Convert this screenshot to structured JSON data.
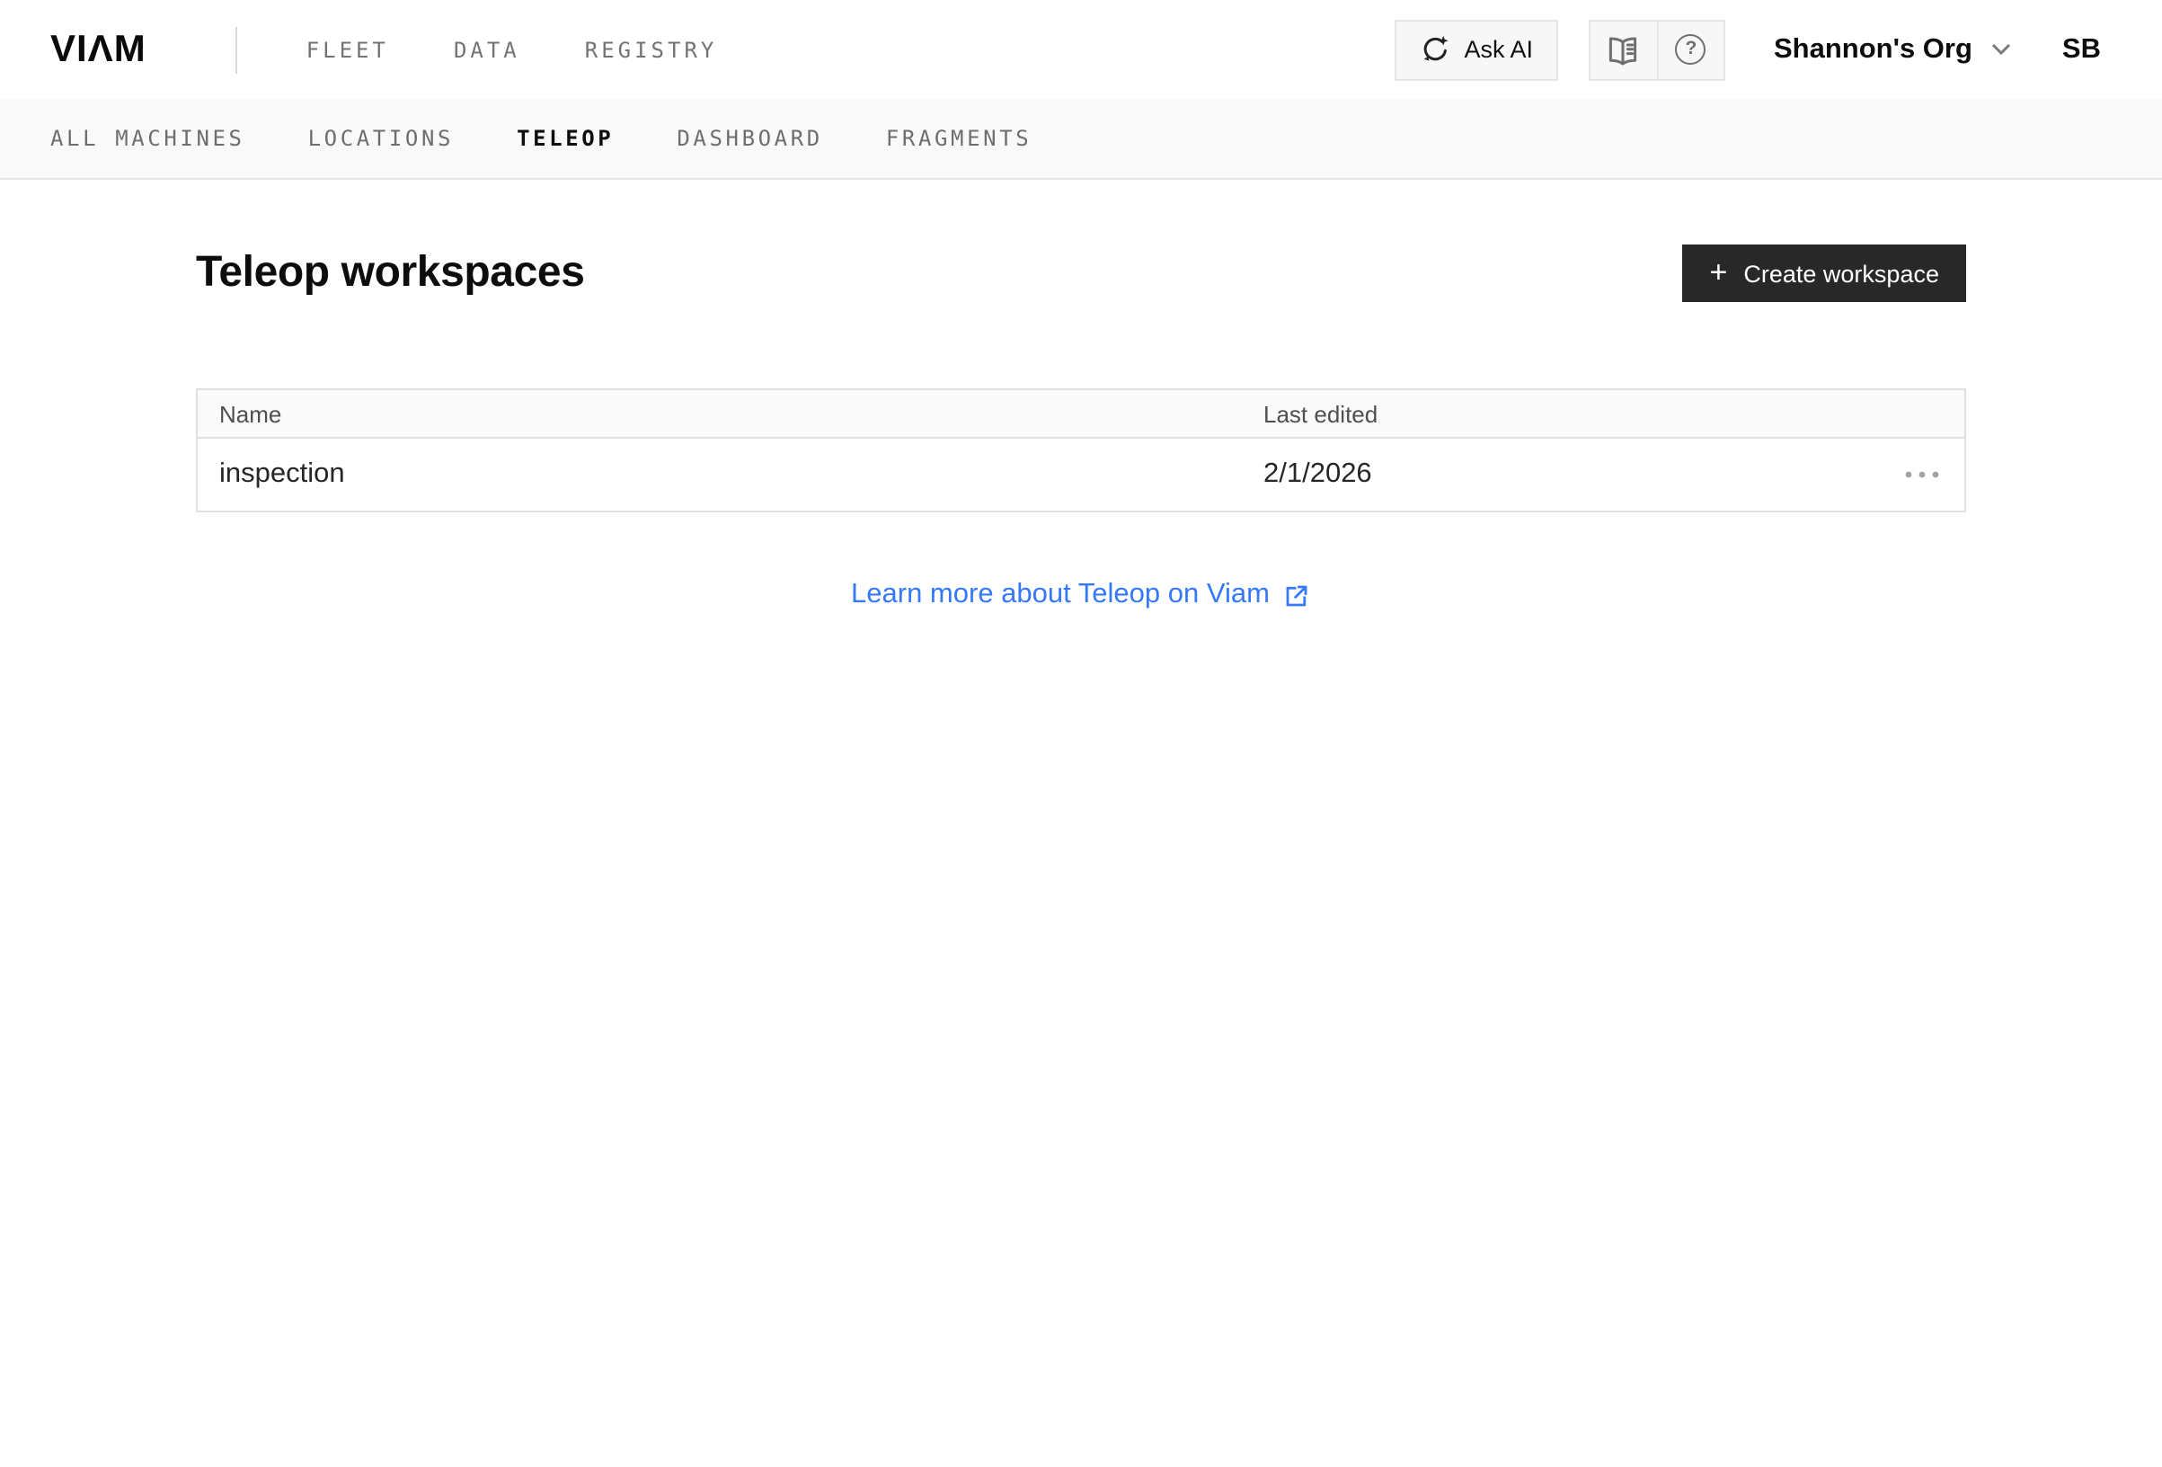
{
  "brand": {
    "logo_text": "VIΛM"
  },
  "header": {
    "nav_items": [
      {
        "label": "FLEET"
      },
      {
        "label": "DATA"
      },
      {
        "label": "REGISTRY"
      }
    ],
    "ask_ai_label": "Ask AI",
    "org_name": "Shannon's Org",
    "avatar_initials": "SB"
  },
  "subnav": {
    "items": [
      {
        "label": "ALL MACHINES",
        "active": false
      },
      {
        "label": "LOCATIONS",
        "active": false
      },
      {
        "label": "TELEOP",
        "active": true
      },
      {
        "label": "DASHBOARD",
        "active": false
      },
      {
        "label": "FRAGMENTS",
        "active": false
      }
    ]
  },
  "main": {
    "title": "Teleop workspaces",
    "create_button_label": "Create workspace",
    "table": {
      "columns": {
        "name": "Name",
        "last_edited": "Last edited"
      },
      "rows": [
        {
          "name": "inspection",
          "last_edited": "2/1/2026"
        }
      ]
    },
    "learn_more_label": "Learn more about Teleop on Viam"
  },
  "icons": {
    "ask_ai": "sparkle-sync-icon",
    "docs": "open-book-icon",
    "help": "question-circle-icon",
    "help_glyph": "?",
    "org_chevron": "chevron-down-icon",
    "plus_glyph": "+",
    "row_menu": "ellipsis-icon",
    "external_link": "external-link-icon"
  },
  "colors": {
    "accent_link": "#3579f6",
    "button_dark": "#282828",
    "subnav_bg": "#f9f9f9",
    "border": "#e0e0e0"
  }
}
